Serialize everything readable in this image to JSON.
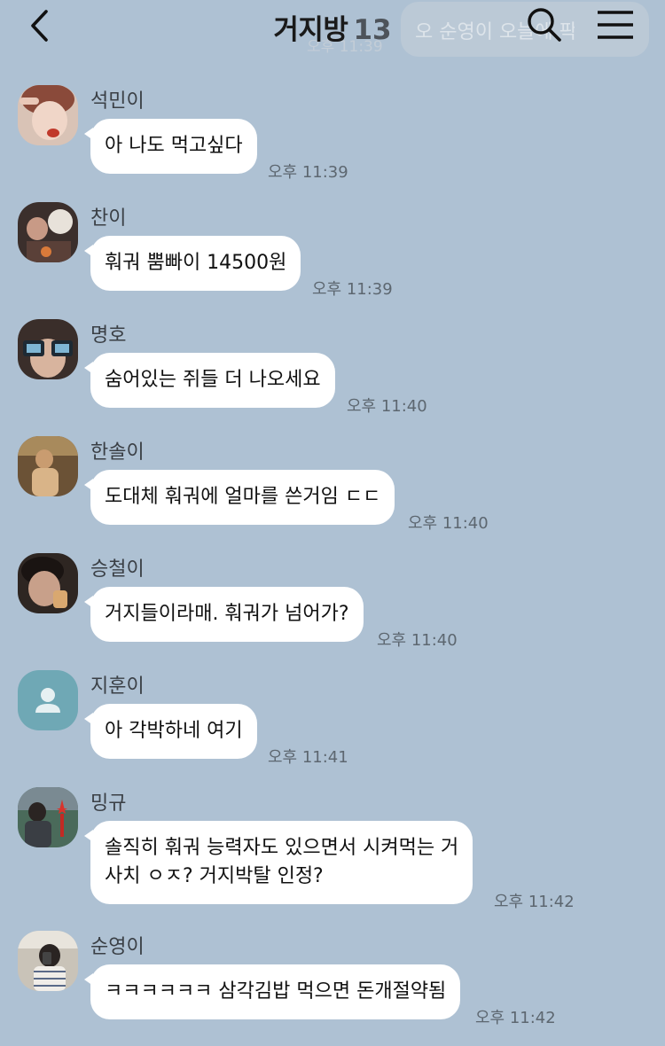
{
  "header": {
    "title": "거지방",
    "member_count": "13",
    "ghost_time": "오후 11:39",
    "ghost_preview": "오 순영이 오늘에 팍"
  },
  "messages": [
    {
      "sender": "석민이",
      "text": "아 나도 먹고싶다",
      "time": "오후 11:39"
    },
    {
      "sender": "찬이",
      "text": "훠궈 뿜빠이 14500원",
      "time": "오후 11:39"
    },
    {
      "sender": "명호",
      "text": "숨어있는 쥐들 더 나오세요",
      "time": "오후 11:40"
    },
    {
      "sender": "한솔이",
      "text": "도대체 훠궈에 얼마를 쓴거임 ㄷㄷ",
      "time": "오후 11:40"
    },
    {
      "sender": "승철이",
      "text": "거지들이라매. 훠궈가 넘어가?",
      "time": "오후 11:40"
    },
    {
      "sender": "지훈이",
      "text": "아 각박하네 여기",
      "time": "오후 11:41"
    },
    {
      "sender": "밍규",
      "text_line1": "솔직히 훠궈 능력자도 있으면서 시켜먹는 거",
      "text_line2": "사치 ㅇㅈ? 거지박탈 인정?",
      "time": "오후 11:42"
    },
    {
      "sender": "순영이",
      "text": "ㅋㅋㅋㅋㅋㅋ 삼각김밥 먹으면 돈개절약됨",
      "time": "오후 11:42"
    }
  ]
}
